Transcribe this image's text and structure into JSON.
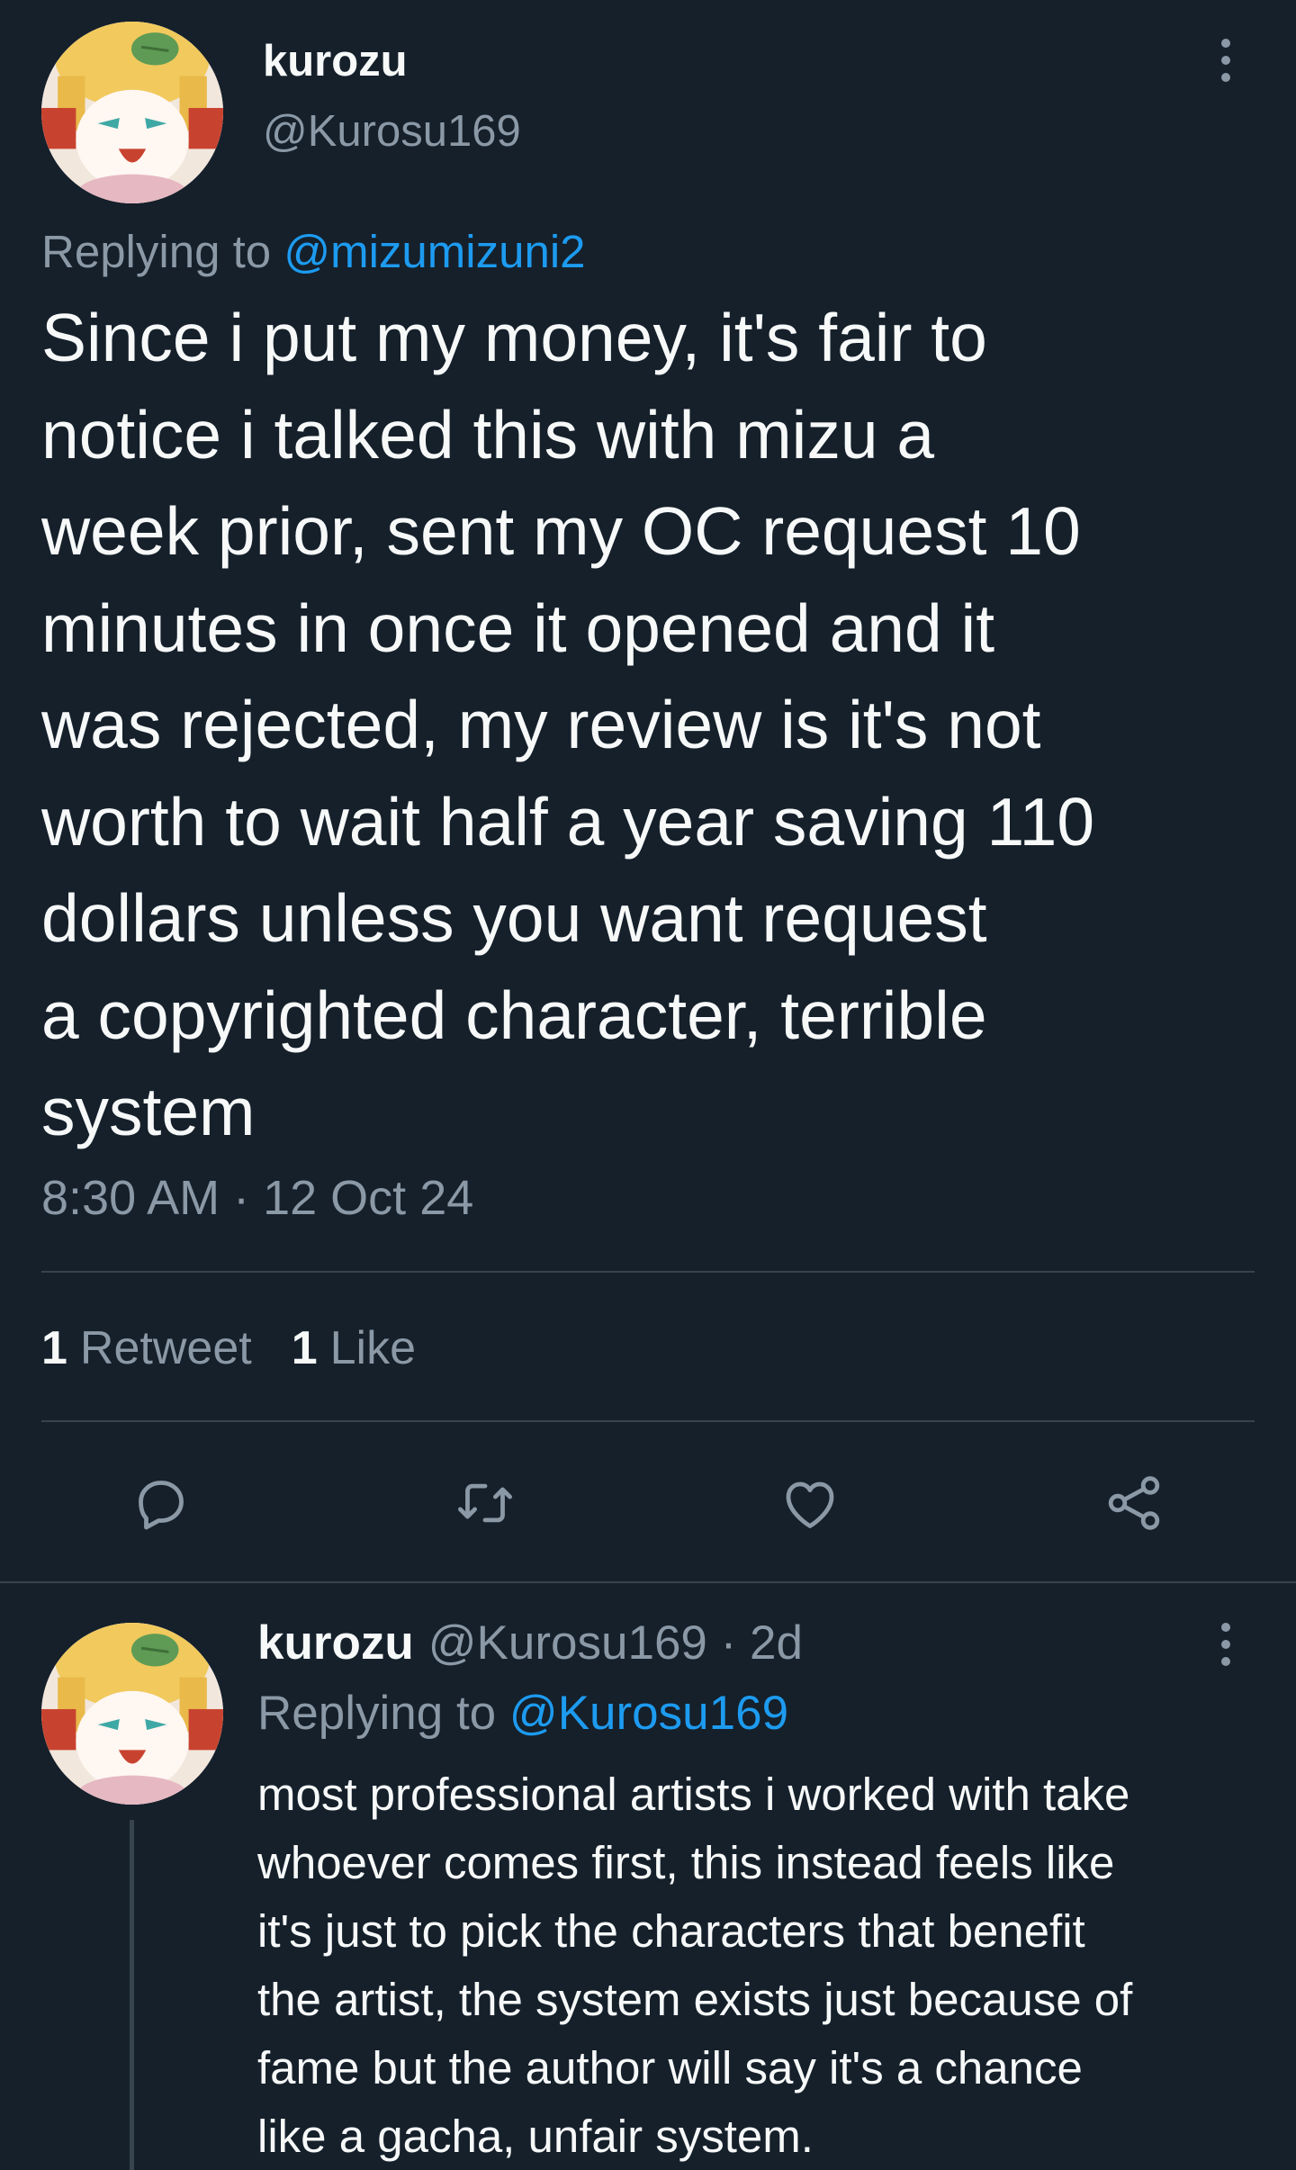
{
  "colors": {
    "background": "#15202b",
    "text_primary": "#f7f9f9",
    "text_secondary": "#8b98a5",
    "link": "#1d9bf0",
    "divider": "#38444d"
  },
  "main_tweet": {
    "author_name": "kurozu",
    "author_handle": "@Kurosu169",
    "replying_prefix": "Replying to ",
    "replying_to": "@mizumizuni2",
    "text_lines": [
      "Since i put my money, it's fair to",
      "notice i talked this with mizu a",
      "week prior, sent my OC request 10",
      "minutes in once it opened and it",
      "was rejected, my review is it's not",
      "worth to wait half a year saving 110",
      "dollars unless you want request",
      "a copyrighted character, terrible",
      "system"
    ],
    "timestamp": "8:30 AM · 12 Oct 24",
    "stats": {
      "retweets_count": "1",
      "retweets_label": "Retweet",
      "likes_count": "1",
      "likes_label": "Like"
    },
    "actions": [
      "reply-icon",
      "retweet-icon",
      "like-icon",
      "share-icon"
    ],
    "more_icon": "more-vertical-icon"
  },
  "reply_tweet": {
    "author_name": "kurozu",
    "author_handle_time": "@Kurosu169 · 2d",
    "replying_prefix": "Replying to ",
    "replying_to": "@Kurosu169",
    "text_lines": [
      "most professional artists i worked with take",
      "whoever comes first, this instead feels like",
      "it's just to pick the characters that benefit",
      "the artist, the system exists just because of",
      "fame but the author will say it's a chance",
      "like a gacha, unfair system."
    ],
    "more_icon": "more-vertical-icon"
  }
}
